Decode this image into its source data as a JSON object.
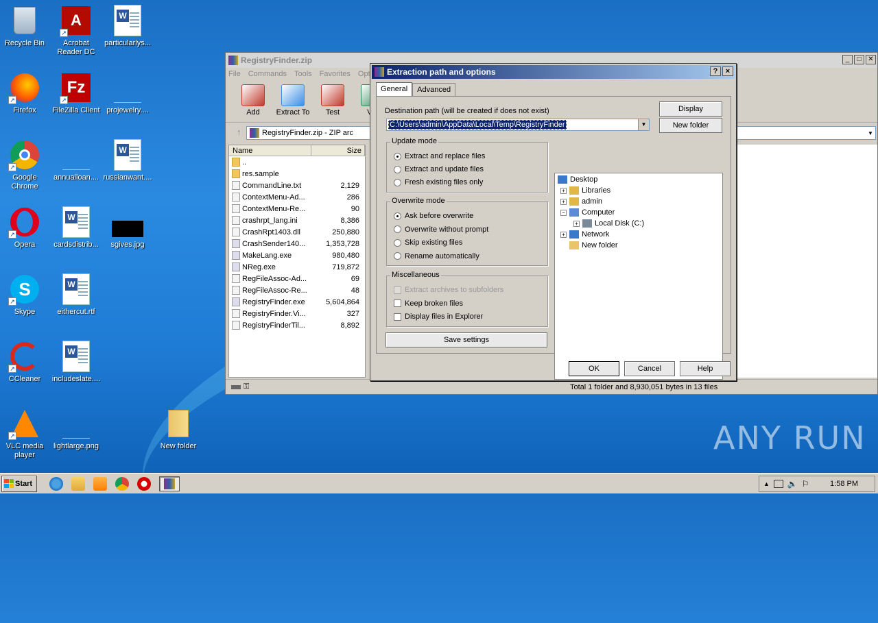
{
  "desktop": {
    "icons": [
      {
        "label": "Recycle Bin",
        "icon": "recycle-bin-icon"
      },
      {
        "label": "Acrobat\nReader DC",
        "icon": "acrobat-icon"
      },
      {
        "label": "particularlys...",
        "icon": "word-doc-icon"
      },
      {
        "label": "Firefox",
        "icon": "firefox-icon"
      },
      {
        "label": "FileZilla Client",
        "icon": "filezilla-icon"
      },
      {
        "label": "projewelry....",
        "icon": "blank-file-icon"
      },
      {
        "label": "Google\nChrome",
        "icon": "chrome-icon"
      },
      {
        "label": "annualloan....",
        "icon": "blank-file-icon"
      },
      {
        "label": "russianwant....",
        "icon": "word-doc-icon"
      },
      {
        "label": "Opera",
        "icon": "opera-icon"
      },
      {
        "label": "cardsdistrib...",
        "icon": "word-doc-icon"
      },
      {
        "label": "sgives.jpg",
        "icon": "image-file-icon"
      },
      {
        "label": "Skype",
        "icon": "skype-icon"
      },
      {
        "label": "eithercut.rtf",
        "icon": "word-doc-icon"
      },
      {
        "label": "CCleaner",
        "icon": "ccleaner-icon"
      },
      {
        "label": "includeslate....",
        "icon": "word-doc-icon"
      },
      {
        "label": "VLC media\nplayer",
        "icon": "vlc-icon"
      },
      {
        "label": "lightlarge.png",
        "icon": "blank-file-icon"
      },
      {
        "label": "New folder",
        "icon": "folder-icon"
      }
    ]
  },
  "rar": {
    "title": "RegistryFinder.zip",
    "menu": [
      "File",
      "Commands",
      "Tools",
      "Favorites",
      "Opt"
    ],
    "toolbar": [
      {
        "label": "Add",
        "icon": "add-archive-icon",
        "color": "#c0392b"
      },
      {
        "label": "Extract To",
        "icon": "extract-icon",
        "color": "#3a8ee6"
      },
      {
        "label": "Test",
        "icon": "test-icon",
        "color": "#c0392b"
      },
      {
        "label": "Vie",
        "icon": "view-icon",
        "color": "#2e8b57"
      }
    ],
    "address": "RegistryFinder.zip - ZIP arc",
    "columns": {
      "name": "Name",
      "size": "Size"
    },
    "files": [
      {
        "name": "..",
        "size": "",
        "type": "folder"
      },
      {
        "name": "res.sample",
        "size": "",
        "type": "folder"
      },
      {
        "name": "CommandLine.txt",
        "size": "2,129",
        "type": "file"
      },
      {
        "name": "ContextMenu-Ad...",
        "size": "286",
        "type": "file"
      },
      {
        "name": "ContextMenu-Re...",
        "size": "90",
        "type": "file"
      },
      {
        "name": "crashrpt_lang.ini",
        "size": "8,386",
        "type": "file"
      },
      {
        "name": "CrashRpt1403.dll",
        "size": "250,880",
        "type": "file"
      },
      {
        "name": "CrashSender140...",
        "size": "1,353,728",
        "type": "exe"
      },
      {
        "name": "MakeLang.exe",
        "size": "980,480",
        "type": "exe"
      },
      {
        "name": "NReg.exe",
        "size": "719,872",
        "type": "exe"
      },
      {
        "name": "RegFileAssoc-Ad...",
        "size": "69",
        "type": "file"
      },
      {
        "name": "RegFileAssoc-Re...",
        "size": "48",
        "type": "file"
      },
      {
        "name": "RegistryFinder.exe",
        "size": "5,604,864",
        "type": "exe"
      },
      {
        "name": "RegistryFinder.Vi...",
        "size": "327",
        "type": "file"
      },
      {
        "name": "RegistryFinderTil...",
        "size": "8,892",
        "type": "file"
      }
    ],
    "status": "Total 1 folder and 8,930,051 bytes in 13 files"
  },
  "dialog": {
    "title": "Extraction path and options",
    "help_btn": "?",
    "close_btn": "×",
    "tabs": [
      "General",
      "Advanced"
    ],
    "dest_label": "Destination path (will be created if does not exist)",
    "dest_value": "C:\\Users\\admin\\AppData\\Local\\Temp\\RegistryFinder",
    "display_btn": "Display",
    "new_folder_btn": "New folder",
    "update_mode": {
      "label": "Update mode",
      "options": [
        "Extract and replace files",
        "Extract and update files",
        "Fresh existing files only"
      ],
      "selected": 0
    },
    "overwrite_mode": {
      "label": "Overwrite mode",
      "options": [
        "Ask before overwrite",
        "Overwrite without prompt",
        "Skip existing files",
        "Rename automatically"
      ],
      "selected": 0
    },
    "misc": {
      "label": "Miscellaneous",
      "options": [
        "Extract archives to subfolders",
        "Keep broken files",
        "Display files in Explorer"
      ]
    },
    "save_btn": "Save settings",
    "tree": [
      {
        "label": "Desktop",
        "level": 0,
        "expander": ""
      },
      {
        "label": "Libraries",
        "level": 1,
        "expander": "+"
      },
      {
        "label": "admin",
        "level": 1,
        "expander": "+"
      },
      {
        "label": "Computer",
        "level": 1,
        "expander": "−"
      },
      {
        "label": "Local Disk (C:)",
        "level": 2,
        "expander": "+"
      },
      {
        "label": "Network",
        "level": 1,
        "expander": "+"
      },
      {
        "label": "New folder",
        "level": 1,
        "expander": ""
      }
    ],
    "ok_btn": "OK",
    "cancel_btn": "Cancel",
    "help_text_btn": "Help"
  },
  "taskbar": {
    "start": "Start",
    "clock": "1:58 PM"
  },
  "watermark": "ANY RUN"
}
